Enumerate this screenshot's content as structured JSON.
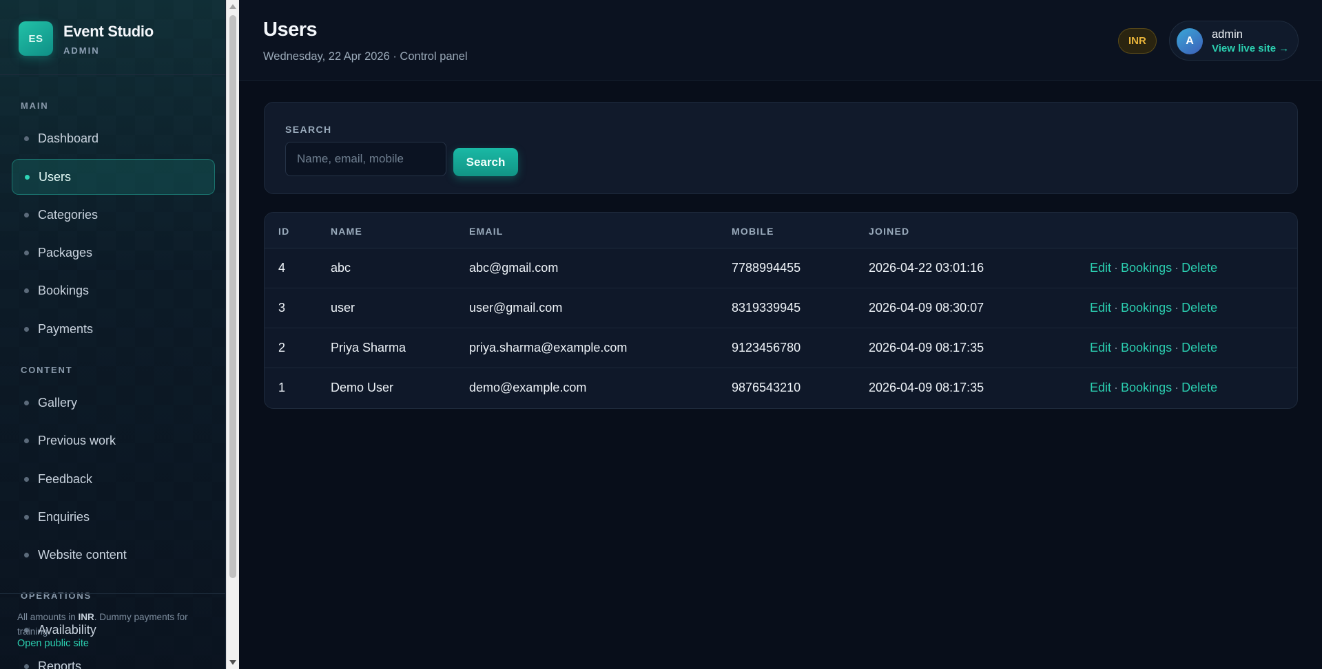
{
  "brand": {
    "logo": "ES",
    "name": "Event Studio",
    "subtitle": "ADMIN"
  },
  "sidebar": {
    "sections": [
      {
        "title": "MAIN",
        "items": [
          "Dashboard",
          "Users",
          "Categories",
          "Packages",
          "Bookings",
          "Payments"
        ]
      },
      {
        "title": "CONTENT",
        "items": [
          "Gallery",
          "Previous work",
          "Feedback",
          "Enquiries",
          "Website content"
        ]
      },
      {
        "title": "OPERATIONS",
        "items": [
          "Availability",
          "Reports"
        ]
      }
    ],
    "active_item": "Users",
    "note_prefix": "All amounts in ",
    "note_bold": "INR",
    "note_suffix": ". Dummy payments for training.",
    "public_link": "Open public site"
  },
  "header": {
    "title": "Users",
    "subtitle": "Wednesday, 22 Apr 2026 · Control panel",
    "currency": "INR",
    "user": {
      "initial": "A",
      "name": "admin",
      "link": "View live site →"
    }
  },
  "search": {
    "label": "SEARCH",
    "placeholder": "Name, email, mobile",
    "value": "",
    "button": "Search"
  },
  "table": {
    "columns": [
      "ID",
      "NAME",
      "EMAIL",
      "MOBILE",
      "JOINED"
    ],
    "actions": [
      "Edit",
      "Bookings",
      "Delete"
    ],
    "rows": [
      {
        "id": "4",
        "name": "abc",
        "email": "abc@gmail.com",
        "mobile": "7788994455",
        "joined": "2026-04-22 03:01:16"
      },
      {
        "id": "3",
        "name": "user",
        "email": "user@gmail.com",
        "mobile": "8319339945",
        "joined": "2026-04-09 08:30:07"
      },
      {
        "id": "2",
        "name": "Priya Sharma",
        "email": "priya.sharma@example.com",
        "mobile": "9123456780",
        "joined": "2026-04-09 08:17:35"
      },
      {
        "id": "1",
        "name": "Demo User",
        "email": "demo@example.com",
        "mobile": "9876543210",
        "joined": "2026-04-09 08:17:35"
      }
    ]
  },
  "colors": {
    "accent": "#2bd0b1",
    "currency_badge": "#e9b43a",
    "background": "#080e1a"
  }
}
